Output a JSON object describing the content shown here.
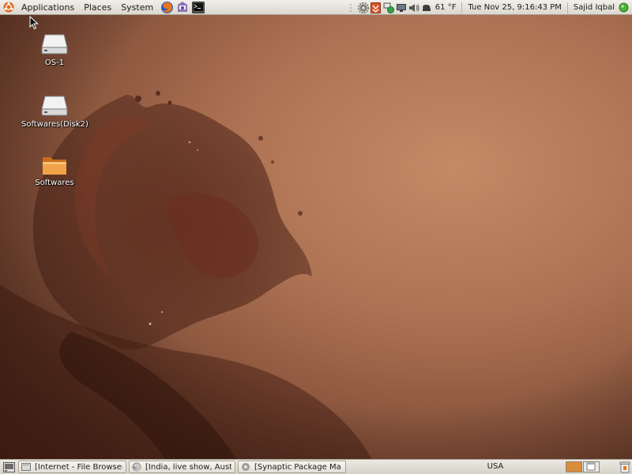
{
  "top_panel": {
    "menus": [
      {
        "label": "Applications"
      },
      {
        "label": "Places"
      },
      {
        "label": "System"
      }
    ],
    "launchers": [
      "firefox-icon",
      "evolution-mail-icon",
      "terminal-icon"
    ],
    "tray_icons": [
      "system-settings-icon",
      "update-notifier-icon",
      "network-manager-icon",
      "display-icon",
      "volume-icon",
      "weather-icon"
    ],
    "temperature": "61 °F",
    "clock": "Tue Nov 25,  9:16:43 PM",
    "user_name": "Sajid Iqbal",
    "user_status_color": "#4caf37"
  },
  "desktop": {
    "icons": [
      {
        "label": "OS-1",
        "icon": "drive-icon"
      },
      {
        "label": "Softwares(Disk2)",
        "icon": "drive-icon"
      },
      {
        "label": "Softwares",
        "icon": "folder-icon"
      }
    ]
  },
  "bottom_panel": {
    "tasks": [
      {
        "label": "[Internet - File Browser]",
        "icon": "file-browser-icon"
      },
      {
        "label": "[India, live show, Austr",
        "icon": "firefox-icon"
      },
      {
        "label": "[Synaptic Package Ma",
        "icon": "synaptic-icon"
      }
    ],
    "keyboard_layout": "USA",
    "workspaces": 2,
    "active_workspace": 1
  },
  "colors": {
    "panel_bg": "#e6e3db",
    "workspace_active": "#d98c3a",
    "workspace_inactive": "#ece9e3"
  }
}
